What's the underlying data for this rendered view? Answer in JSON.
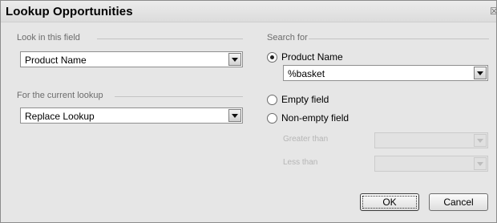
{
  "window": {
    "title": "Lookup Opportunities"
  },
  "look_in": {
    "label": "Look in this field",
    "value": "Product Name"
  },
  "current_lookup": {
    "label": "For the current lookup",
    "value": "Replace Lookup"
  },
  "search_for": {
    "label": "Search for",
    "option_product": "Product Name",
    "search_value": "%basket",
    "option_empty": "Empty field",
    "option_nonempty": "Non-empty field",
    "greater_label": "Greater than",
    "less_label": "Less than"
  },
  "buttons": {
    "ok": "OK",
    "cancel": "Cancel"
  },
  "icons": {
    "close": "close-icon",
    "dropdown": "chevron-down-icon"
  },
  "colors": {
    "dialog_bg": "#e6e6e6",
    "field_bg": "#ffffff",
    "disabled_text": "#b5b5b5"
  }
}
